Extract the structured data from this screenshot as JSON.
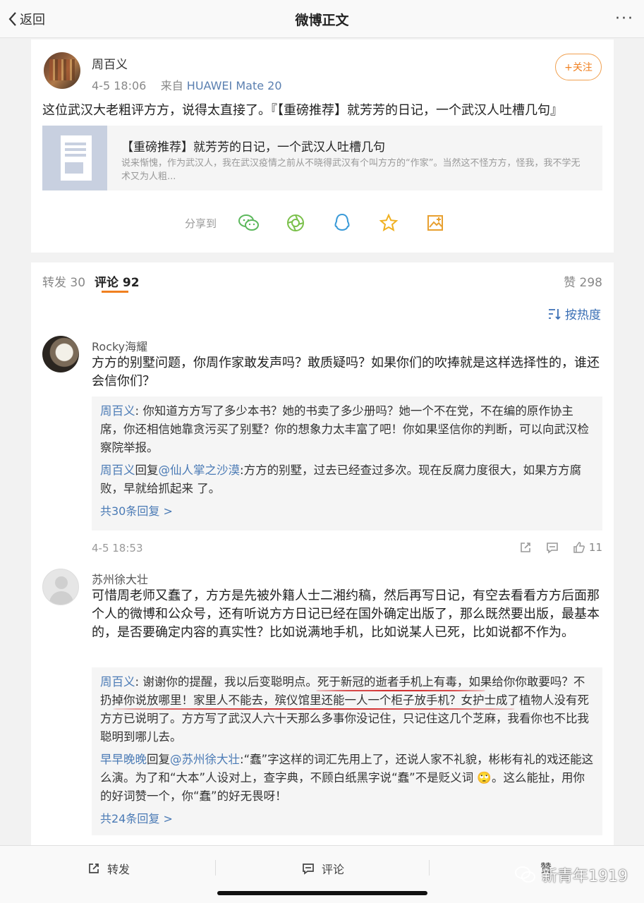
{
  "navbar": {
    "back_label": "返回",
    "title": "微博正文",
    "more_label": "···"
  },
  "post": {
    "author": "周百义",
    "time": "4-5 18:06",
    "source_prefix": "来自",
    "device": "HUAWEI Mate 20",
    "follow_label": "+关注",
    "text": "这位武汉大老粗评方方，说得太直接了。『【重磅推荐】就芳芳的日记，一个武汉人吐槽几句』",
    "article": {
      "title": "【重磅推荐】就芳芳的日记，一个武汉人吐槽几句",
      "desc": "说来惭愧，作为武汉人，我在武汉疫情之前从不晓得武汉有个叫方方的“作家”。当然这不怪方方，怪我，我不学无术又为人粗..."
    },
    "share_label": "分享到",
    "share_icons": [
      "wechat-icon",
      "moments-icon",
      "qq-icon",
      "favorite-icon",
      "image-save-icon"
    ]
  },
  "tabs": {
    "repost": "转发 30",
    "comment": "评论 92",
    "like": "赞 298"
  },
  "sort_label": "按热度",
  "comments": [
    {
      "name": "Rocky海耀",
      "text": "方方的别墅问题，你周作家敢发声吗？敢质疑吗？如果你们的吹捧就是这样选择性的，谁还会信你们？",
      "replies": [
        {
          "user": "周百义",
          "sep": ": ",
          "text": "你知道方方写了多少本书？她的书卖了多少册吗？她一个不在党，不在编的原作协主席，你还相信她靠贪污买了别墅？你的想象力太丰富了吧！你如果坚信你的判断，可以向武汉检察院举报。"
        },
        {
          "user": "周百义",
          "mid": "回复",
          "target": "@仙人掌之沙漠",
          "sep": ":",
          "text": "方方的别墅，过去已经查过多次。现在反腐力度很大，如果方方腐败，早就给抓起来 了。"
        }
      ],
      "more": "共30条回复 >",
      "time": "4-5 18:53",
      "likes": "11"
    },
    {
      "name": "苏州徐大壮",
      "text": "可惜周老师又蠢了，方方是先被外籍人士二湘约稿，然后再写日记，有空去看看方方后面那个人的微博和公众号，还有听说方方日记已经在国外确定出版了，那么既然要出版，最基本的，是否要确定内容的真实性？比如说满地手机，比如说某人已死，比如说都不作为。",
      "replies": [
        {
          "user": "周百义",
          "sep": ": ",
          "text": "谢谢你的提醒，我以后变聪明点。死于新冠的逝者手机上有毒，如果给你你敢要吗？不扔掉你说放哪里！家里人不能去，殡仪馆里还能一人一个柜子放手机？女护士成了植物人没有死方方已说明了。方方写了武汉人六十天那么多事你没记住，只记住这几个芝麻，我看你也不比我聪明到哪儿去。"
        },
        {
          "user": "早早晚晚",
          "mid": "回复",
          "target": "@苏州徐大壮",
          "sep": ":",
          "text": "“蠢”字这样的词汇先用上了，还说人家不礼貌，彬彬有礼的戏还能这么演。为了和“大本”人设对上，查字典，不顾白纸黑字说“蠢”不是贬义词 🙄。这么能扯，用你的好词赞一个，你“蠢”的好无畏呀！"
        }
      ],
      "more": "共24条回复 >"
    }
  ],
  "bottombar": {
    "repost": "转发",
    "comment": "评论",
    "like": "赞"
  },
  "watermark": "新青年1919",
  "colors": {
    "accent": "#f08020",
    "link": "#4a7ab5",
    "annotation": "#d23030"
  }
}
